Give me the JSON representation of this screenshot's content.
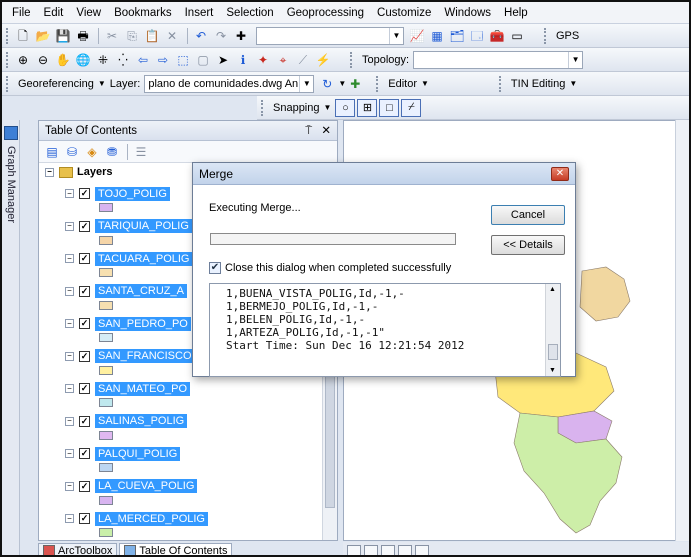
{
  "menu": [
    "File",
    "Edit",
    "View",
    "Bookmarks",
    "Insert",
    "Selection",
    "Geoprocessing",
    "Customize",
    "Windows",
    "Help"
  ],
  "toolbar": {
    "gps_label": "GPS",
    "topology_label": "Topology:",
    "georeferencing_label": "Georeferencing",
    "layer_label": "Layer:",
    "layer_value": "plano de comunidades.dwg Annotati",
    "editor_label": "Editor",
    "tin_editing_label": "TIN Editing",
    "snapping_label": "Snapping"
  },
  "graph_manager": {
    "label": "Graph Manager"
  },
  "toc": {
    "title": "Table Of Contents",
    "pin": "⍑",
    "close": "✕",
    "root_label": "Layers",
    "layers": [
      {
        "name": "TOJO_POLIG",
        "color": "#d8b4f0"
      },
      {
        "name": "TARIQUIA_POLIG",
        "color": "#f5d5a8"
      },
      {
        "name": "TACUARA_POLIG",
        "color": "#f7e0b0"
      },
      {
        "name": "SANTA_CRUZ_A",
        "color": "#f6dfb0"
      },
      {
        "name": "SAN_PEDRO_PO",
        "color": "#d6ecf5"
      },
      {
        "name": "SAN_FRANCISCO",
        "color": "#fff0a0"
      },
      {
        "name": "SAN_MATEO_PO",
        "color": "#bfe8ee"
      },
      {
        "name": "SALINAS_POLIG",
        "color": "#e0b8f0"
      },
      {
        "name": "PALQUI_POLIG",
        "color": "#bcd6f2"
      },
      {
        "name": "LA_CUEVA_POLIG",
        "color": "#d8b4f0"
      },
      {
        "name": "LA_MERCED_POLIG",
        "color": "#c9efa8"
      }
    ]
  },
  "bottom_tabs": [
    "ArcToolbox",
    "Table Of Contents"
  ],
  "dialog": {
    "title": "Merge",
    "executing": "Executing Merge...",
    "cancel": "Cancel",
    "details": "<< Details",
    "progress": 0,
    "close_when_done": "Close this dialog when completed successfully",
    "close_when_done_checked": true,
    "log": "1,BUENA_VISTA_POLIG,Id,-1,-\n1,BERMEJO_POLIG,Id,-1,-\n1,BELEN_POLIG,Id,-1,-\n1,ARTEZA_POLIG,Id,-1,-1\"\nStart Time: Sun Dec 16 12:21:54 2012"
  },
  "map": {
    "colors": {
      "yellow": "#ffe87a",
      "purple": "#d9b3ee",
      "green": "#cdeea8",
      "tan": "#f1d7a0"
    }
  }
}
